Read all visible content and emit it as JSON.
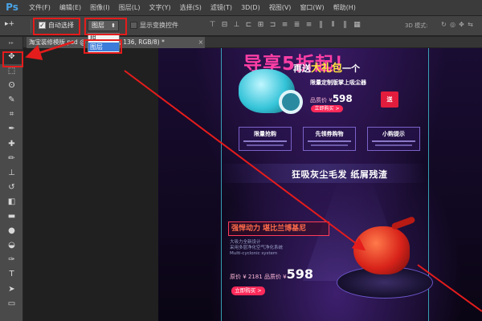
{
  "app": {
    "logo": "Ps"
  },
  "menu": [
    "文件(F)",
    "编辑(E)",
    "图像(I)",
    "图层(L)",
    "文字(Y)",
    "选择(S)",
    "滤镜(T)",
    "3D(D)",
    "视图(V)",
    "窗口(W)",
    "帮助(H)"
  ],
  "options": {
    "tool_icon": "▸+",
    "auto_select_label": "自动选择",
    "auto_select_checked": "✓",
    "target_value": "图层",
    "transform_label": "显示变换控件",
    "mode3d_label": "3D 模式:"
  },
  "dropdown": {
    "options": [
      "组",
      "图层"
    ],
    "selected": "图层"
  },
  "document": {
    "tab_title": "淘宝装修模版.psd @ 100% (图层 136, RGB/8) *",
    "close": "×"
  },
  "artwork": {
    "headline": "导享5折起！",
    "subline_prefix": "再送",
    "subline_emph": "大礼包",
    "subline_suffix": "一个",
    "product1_title": "限量定制版掌上吸尘器",
    "product1_price_label": "品质价 ¥",
    "product1_price": "598",
    "buy_label": "立即购买 >",
    "gift_label": "送",
    "features": [
      "限量抢购",
      "先领券购物",
      "小购提示"
    ],
    "slogan": "狂吸灰尘毛发  纸屑残渣",
    "power_title": "强悍动力 堪比兰博基尼",
    "desc_lines": [
      "大吸力全新设计",
      "采用多层净化空气净化系统",
      "Multi-cyclonic system"
    ],
    "price2_label": "原价 ¥ 2181  品质价 ¥",
    "price2": "598",
    "buy2_label": "立即购买 >"
  },
  "icons": {
    "move_tool": "move-tool-icon",
    "dropdown_arrow": "chevron-updown-icon",
    "close": "close-icon"
  }
}
